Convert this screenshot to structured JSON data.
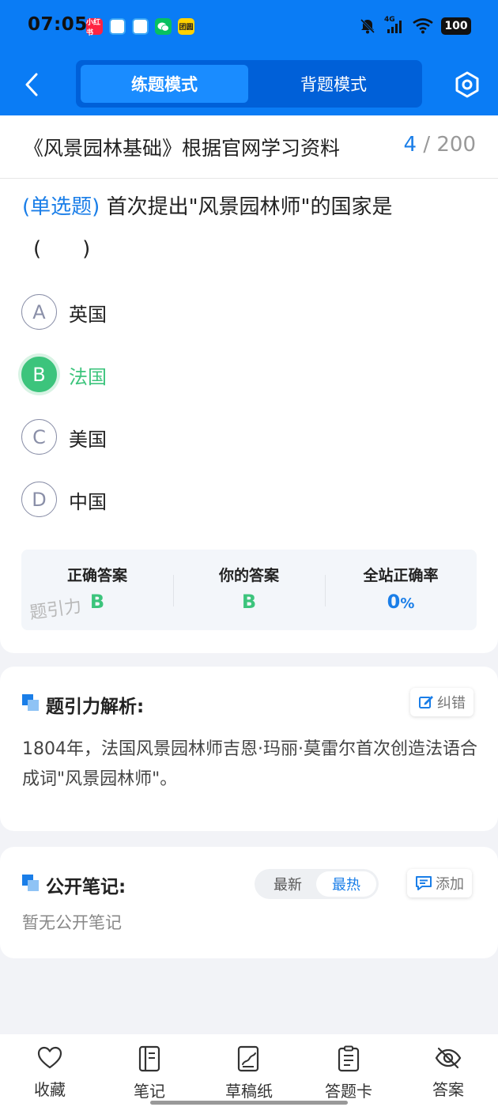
{
  "status_bar": {
    "time": "07:05",
    "network": "4G",
    "battery": "100",
    "app_icons": [
      {
        "name": "xiaohongshu-icon",
        "label": "小红书",
        "color": "#ff2442"
      },
      {
        "name": "chat-bubble-icon",
        "label": "",
        "color": "#3aa6f5"
      },
      {
        "name": "chat-bubble-2-icon",
        "label": "",
        "color": "#3aa6f5"
      },
      {
        "name": "wechat-icon",
        "label": "",
        "color": "#07c160"
      },
      {
        "name": "meituan-icon",
        "label": "团圆",
        "color": "#ffd100"
      }
    ]
  },
  "header": {
    "tabs": [
      {
        "label": "练题模式",
        "active": true
      },
      {
        "label": "背题模式",
        "active": false
      }
    ]
  },
  "question": {
    "bank_title": "《风景园林基础》根据官网学习资料",
    "current": "4",
    "separator": "/",
    "total": "200",
    "type": "(单选题)",
    "text": "首次提出\"风景园林师\"的国家是",
    "paren": "(　　)",
    "options": [
      {
        "letter": "A",
        "text": "英国",
        "selected": false
      },
      {
        "letter": "B",
        "text": "法国",
        "selected": true
      },
      {
        "letter": "C",
        "text": "美国",
        "selected": false
      },
      {
        "letter": "D",
        "text": "中国",
        "selected": false
      }
    ]
  },
  "answer_summary": {
    "correct_label": "正确答案",
    "correct_value": "B",
    "yours_label": "你的答案",
    "yours_value": "B",
    "rate_label": "全站正确率",
    "rate_value": "0",
    "rate_unit": "%",
    "watermark": "题引力",
    "colors": {
      "green": "#3cc47c",
      "blue": "#1a7ee8"
    }
  },
  "analysis": {
    "title": "题引力解析:",
    "report_label": "纠错",
    "text": "1804年，法国风景园林师吉恩·玛丽·莫雷尔首次创造法语合成词\"风景园林师\"。"
  },
  "notes": {
    "title": "公开笔记:",
    "sort_options": [
      {
        "label": "最新",
        "active": false
      },
      {
        "label": "最热",
        "active": true
      }
    ],
    "add_label": "添加",
    "empty_text": "暂无公开笔记"
  },
  "bottom_nav": [
    {
      "label": "收藏",
      "icon": "heart-icon"
    },
    {
      "label": "笔记",
      "icon": "notebook-icon"
    },
    {
      "label": "草稿纸",
      "icon": "draft-paper-icon"
    },
    {
      "label": "答题卡",
      "icon": "answer-sheet-icon"
    },
    {
      "label": "答案",
      "icon": "eye-hidden-icon"
    }
  ]
}
